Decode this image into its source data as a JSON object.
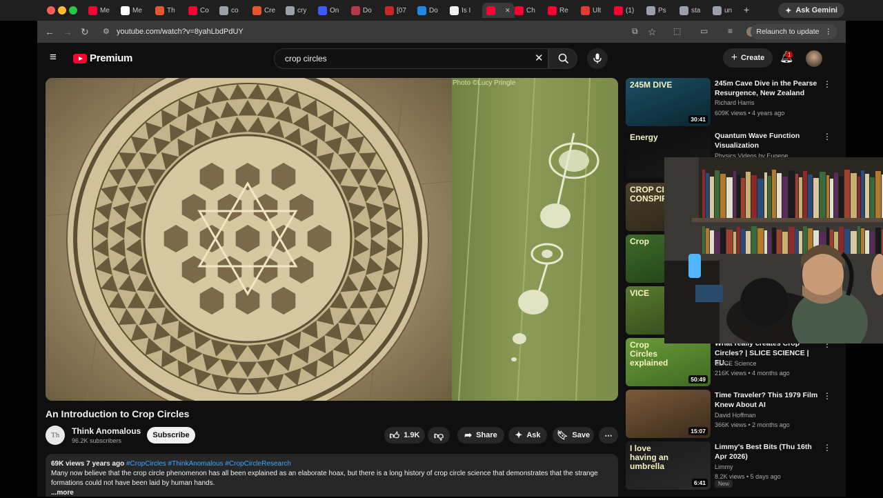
{
  "browser": {
    "tabs": [
      {
        "label": "Me",
        "color": "#ff0033"
      },
      {
        "label": "Me",
        "color": "#ffffff"
      },
      {
        "label": "Th",
        "color": "#e4572e"
      },
      {
        "label": "Co",
        "color": "#ff0033"
      },
      {
        "label": "co",
        "color": "#9aa0a6"
      },
      {
        "label": "Cre",
        "color": "#e4572e"
      },
      {
        "label": "cry",
        "color": "#9aa0a6"
      },
      {
        "label": "On",
        "color": "#3d5afe"
      },
      {
        "label": "Do",
        "color": "#b23a48"
      },
      {
        "label": "[07",
        "color": "#c62828"
      },
      {
        "label": "Do",
        "color": "#1e88e5"
      },
      {
        "label": "Is I",
        "color": "#f1f1f1"
      },
      {
        "label": "",
        "color": "#ff0033"
      },
      {
        "label": "Ch",
        "color": "#ff0033"
      },
      {
        "label": "Re",
        "color": "#ff0033"
      },
      {
        "label": "Ult",
        "color": "#e53935"
      },
      {
        "label": "(1)",
        "color": "#ff0033"
      },
      {
        "label": "Ps",
        "color": "#9aa0a6"
      },
      {
        "label": "sta",
        "color": "#9aa0a6"
      },
      {
        "label": "un",
        "color": "#9aa0a6"
      }
    ],
    "new_tab": "+",
    "ask_gemini": "Ask Gemini",
    "url": "youtube.com/watch?v=8yahLbdPdUY",
    "relaunch": "Relaunch to update"
  },
  "youtube": {
    "logo_text": "Premium",
    "search_value": "crop circles",
    "create_label": "Create",
    "notification_count": "1"
  },
  "video": {
    "photo_credit": "Photo ©Lucy Pringle",
    "title": "An Introduction to Crop Circles",
    "channel": "Think Anomalous",
    "channel_avatar": "Th",
    "subscribers": "96.2K subscribers",
    "subscribe_label": "Subscribe",
    "likes": "1.9K",
    "share_label": "Share",
    "ask_label": "Ask",
    "save_label": "Save",
    "views": "69K views",
    "age": "7 years ago",
    "tags": "#CropCircles #ThinkAnomalous #CropCircleResearch",
    "description": "Many now believe that the crop circle phenomenon has all been explained as an elaborate hoax, but there is a long history of crop circle science that demonstrates that the strange formations could not have been laid by human hands.",
    "more": "...more"
  },
  "recommendations": [
    {
      "title": "245m Cave Dive in the Pearse Resurgence, New Zealand",
      "channel": "Richard Harris",
      "meta": "609K views • 4 years ago",
      "duration": "30:41",
      "thumb_text": "245M DIVE",
      "colors": [
        "#1b4f63",
        "#0a2530"
      ]
    },
    {
      "title": "Quantum Wave Function Visualization",
      "channel": "Physics Videos by Eugene Khutoryansky",
      "meta": "",
      "duration": "",
      "thumb_text": "Energy",
      "colors": [
        "#0d0d0d",
        "#1a1a1a"
      ]
    },
    {
      "title": "",
      "channel": "",
      "meta": "",
      "duration": "",
      "thumb_text": "CROP CIR CONSPIRA",
      "colors": [
        "#4a3f2a",
        "#2a2418"
      ]
    },
    {
      "title": "",
      "channel": "",
      "meta": "",
      "duration": "",
      "thumb_text": "Crop",
      "colors": [
        "#3d6b2a",
        "#1f3d15"
      ]
    },
    {
      "title": "",
      "channel": "",
      "meta": "",
      "duration": "",
      "thumb_text": "VICE",
      "colors": [
        "#5a7a2e",
        "#2e4418"
      ]
    },
    {
      "title": "What really creates Crop Circles? | SLICE SCIENCE | FU...",
      "channel": "SLICE Science",
      "meta": "216K views • 4 months ago",
      "duration": "50:49",
      "thumb_text": "Crop Circles explained",
      "colors": [
        "#6a9a3a",
        "#3e6a22"
      ]
    },
    {
      "title": "Time Traveler? This 1979 Film Knew About AI",
      "channel": "David Hoffman",
      "meta": "366K views • 2 months ago",
      "duration": "15:07",
      "thumb_text": "",
      "colors": [
        "#7a5a3a",
        "#3a2a1a"
      ]
    },
    {
      "title": "Limmy's Best Bits (Thu 16th Apr 2026)",
      "channel": "Limmy",
      "meta": "8.2K views • 5 days ago",
      "duration": "6:41",
      "thumb_text": "I love having an umbrella",
      "colors": [
        "#1a1a1a",
        "#2a2a2a"
      ],
      "badge": "New"
    }
  ]
}
